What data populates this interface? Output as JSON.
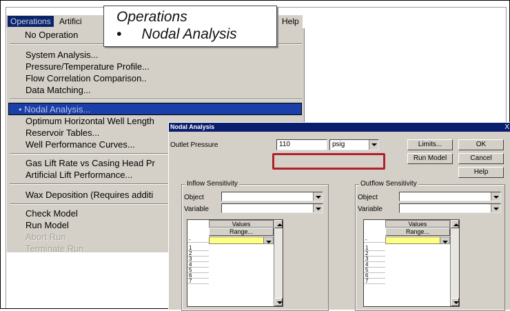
{
  "menubar": {
    "items": [
      {
        "label": "Operations"
      },
      {
        "label": "Artifici"
      },
      {
        "label": "Help"
      }
    ]
  },
  "menu": {
    "items": [
      {
        "label": "No Operation"
      },
      {
        "label": "System Analysis..."
      },
      {
        "label": "Pressure/Temperature Profile..."
      },
      {
        "label": "Flow Correlation Comparison.."
      },
      {
        "label": "Data Matching..."
      },
      {
        "label": "• Nodal Analysis..."
      },
      {
        "label": "Optimum Horizontal Well Length"
      },
      {
        "label": "Reservoir Tables..."
      },
      {
        "label": "Well Performance Curves..."
      },
      {
        "label": "Gas Lift Rate vs Casing Head Pr"
      },
      {
        "label": "Artificial Lift Performance..."
      },
      {
        "label": "Wax Deposition (Requires additi"
      },
      {
        "label": "Check Model"
      },
      {
        "label": "Run Model"
      },
      {
        "label": "Abort Run"
      },
      {
        "label": "Terminate Run"
      }
    ]
  },
  "callout": {
    "line1": "Operations",
    "line2": "•     Nodal Analysis"
  },
  "dialog": {
    "title": "Nodal Analysis",
    "close_glyph": "X",
    "outlet_pressure_label": "Outlet Pressure",
    "outlet_pressure_value": "110",
    "outlet_unit": "psig",
    "buttons": {
      "limits": "Limits...",
      "ok": "OK",
      "run_model": "Run Model",
      "cancel": "Cancel",
      "help": "Help"
    },
    "inflow": {
      "group_label": "Inflow Sensitivity",
      "object_label": "Object",
      "variable_label": "Variable"
    },
    "outflow": {
      "group_label": "Outflow Sensitivity",
      "object_label": "Object",
      "variable_label": "Variable"
    },
    "grid": {
      "values_header": "Values",
      "range_button": "Range...",
      "dash": "-",
      "rows": [
        "1",
        "2",
        "3",
        "4",
        "5",
        "6",
        "7"
      ]
    }
  },
  "colors": {
    "menu_bg": "#d4d0c8",
    "highlight": "#1a3fa8",
    "title_bar": "#0a1e6e",
    "callout_border": "#b0202a",
    "grid_selected": "#ffff80"
  }
}
